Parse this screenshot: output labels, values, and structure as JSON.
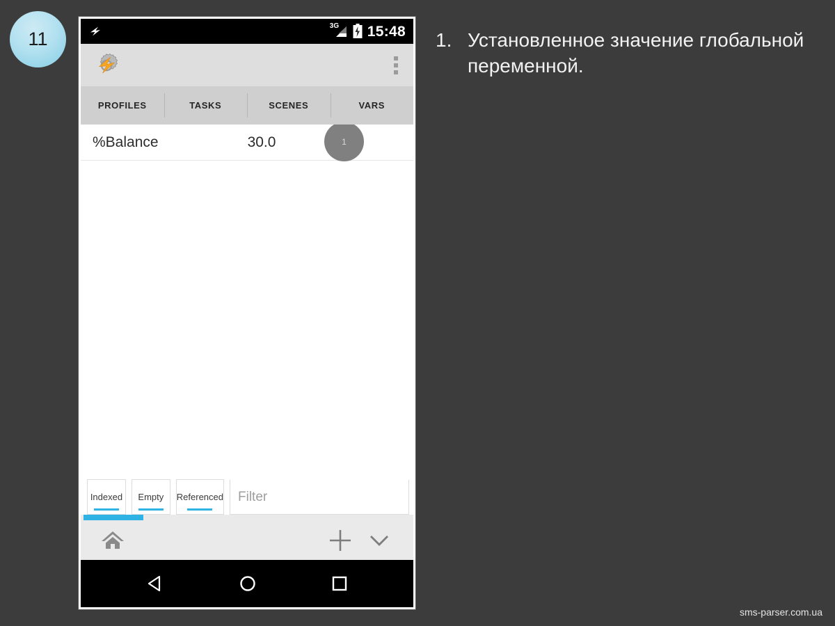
{
  "slide": {
    "number": "11",
    "badge_color": "#9fd9ec",
    "background_color": "#3c3c3c",
    "caption": {
      "marker": "1.",
      "text": "Установленное значение глобальной переменной."
    },
    "footer": "sms-parser.com.ua"
  },
  "phone": {
    "status_bar": {
      "notification_icon": "lightning-bolt-icon",
      "network": "3G",
      "signal_icon": "signal-bars-icon",
      "battery_icon": "battery-charging-icon",
      "clock": "15:48"
    },
    "app_bar": {
      "logo_icon": "tasker-gear-bolt-icon",
      "overflow_icon": "overflow-menu-icon"
    },
    "tabs": {
      "active_index": 3,
      "accent_color": "#2fb3e4",
      "items": [
        {
          "label": "PROFILES"
        },
        {
          "label": "TASKS"
        },
        {
          "label": "SCENES"
        },
        {
          "label": "VARS"
        }
      ]
    },
    "variables": {
      "rows": [
        {
          "name": "%Balance",
          "value": "30.0"
        }
      ]
    },
    "tap_indicator": {
      "label": "1",
      "color": "#808080"
    },
    "filter_bar": {
      "buttons": [
        {
          "label": "Indexed"
        },
        {
          "label": "Empty"
        },
        {
          "label": "Referenced"
        }
      ],
      "filter_placeholder": "Filter",
      "filter_value": ""
    },
    "scrollbar": {
      "color": "#2fb3e4"
    },
    "action_bar": {
      "home_icon": "home-icon",
      "add_icon": "plus-icon",
      "collapse_icon": "chevron-down-icon"
    },
    "nav_bar": {
      "back_icon": "back-triangle-icon",
      "home_icon": "home-circle-icon",
      "recents_icon": "recents-square-icon"
    }
  }
}
